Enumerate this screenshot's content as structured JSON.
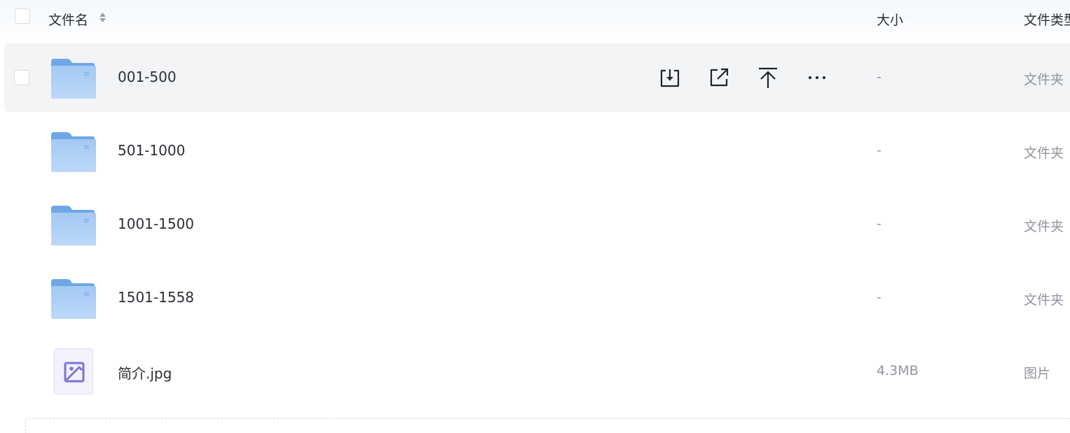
{
  "columns": {
    "name": "文件名",
    "size": "大小",
    "type": "文件类型"
  },
  "actions": [
    {
      "icon": "download-icon"
    },
    {
      "icon": "share-icon"
    },
    {
      "icon": "move-to-top-icon"
    },
    {
      "icon": "more-icon"
    }
  ],
  "rows": [
    {
      "name": "001-500",
      "size": "-",
      "type": "文件夹",
      "icon": "folder-icon",
      "hovered": true
    },
    {
      "name": "501-1000",
      "size": "-",
      "type": "文件夹",
      "icon": "folder-icon"
    },
    {
      "name": "1001-1500",
      "size": "-",
      "type": "文件夹",
      "icon": "folder-icon"
    },
    {
      "name": "1501-1558",
      "size": "-",
      "type": "文件夹",
      "icon": "folder-icon"
    },
    {
      "name": "简介.jpg",
      "size": "4.3MB",
      "type": "图片",
      "icon": "image-file-icon"
    }
  ],
  "colors": {
    "folder_main": "#9ec7f3",
    "folder_tab": "#6fa7e6",
    "row_hover": "#f3f4f5",
    "image_accent": "#7b74d6"
  }
}
